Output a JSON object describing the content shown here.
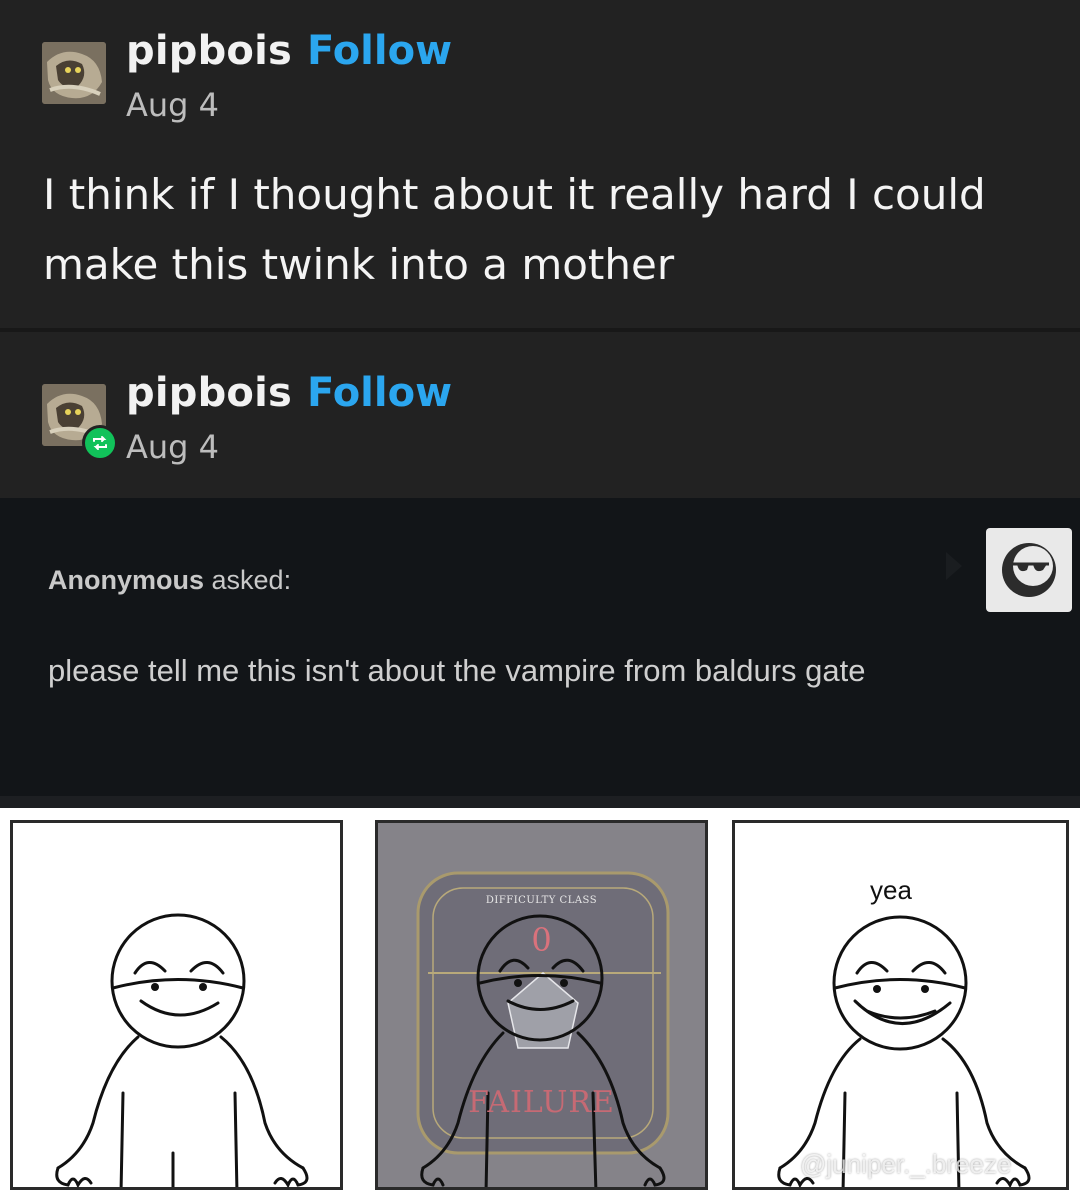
{
  "post": {
    "username": "pipbois",
    "follow_label": "Follow",
    "date": "Aug 4",
    "text": "I think if I thought about it really hard I could make this twink into a mother"
  },
  "reblog": {
    "username": "pipbois",
    "follow_label": "Follow",
    "date": "Aug 4"
  },
  "ask": {
    "asker": "Anonymous",
    "asked_suffix": " asked:",
    "question": "please tell me this isn't about the vampire from baldurs gate"
  },
  "comic": {
    "panel3_caption": "yea",
    "dc_label": "DIFFICULTY CLASS",
    "dc_value": "0",
    "result": "FAILURE",
    "watermark": "@juniper._.breeze"
  },
  "colors": {
    "background": "#222222",
    "follow": "#2ba6ef",
    "reblog_badge": "#11c25a",
    "ask_background": "#121518"
  }
}
